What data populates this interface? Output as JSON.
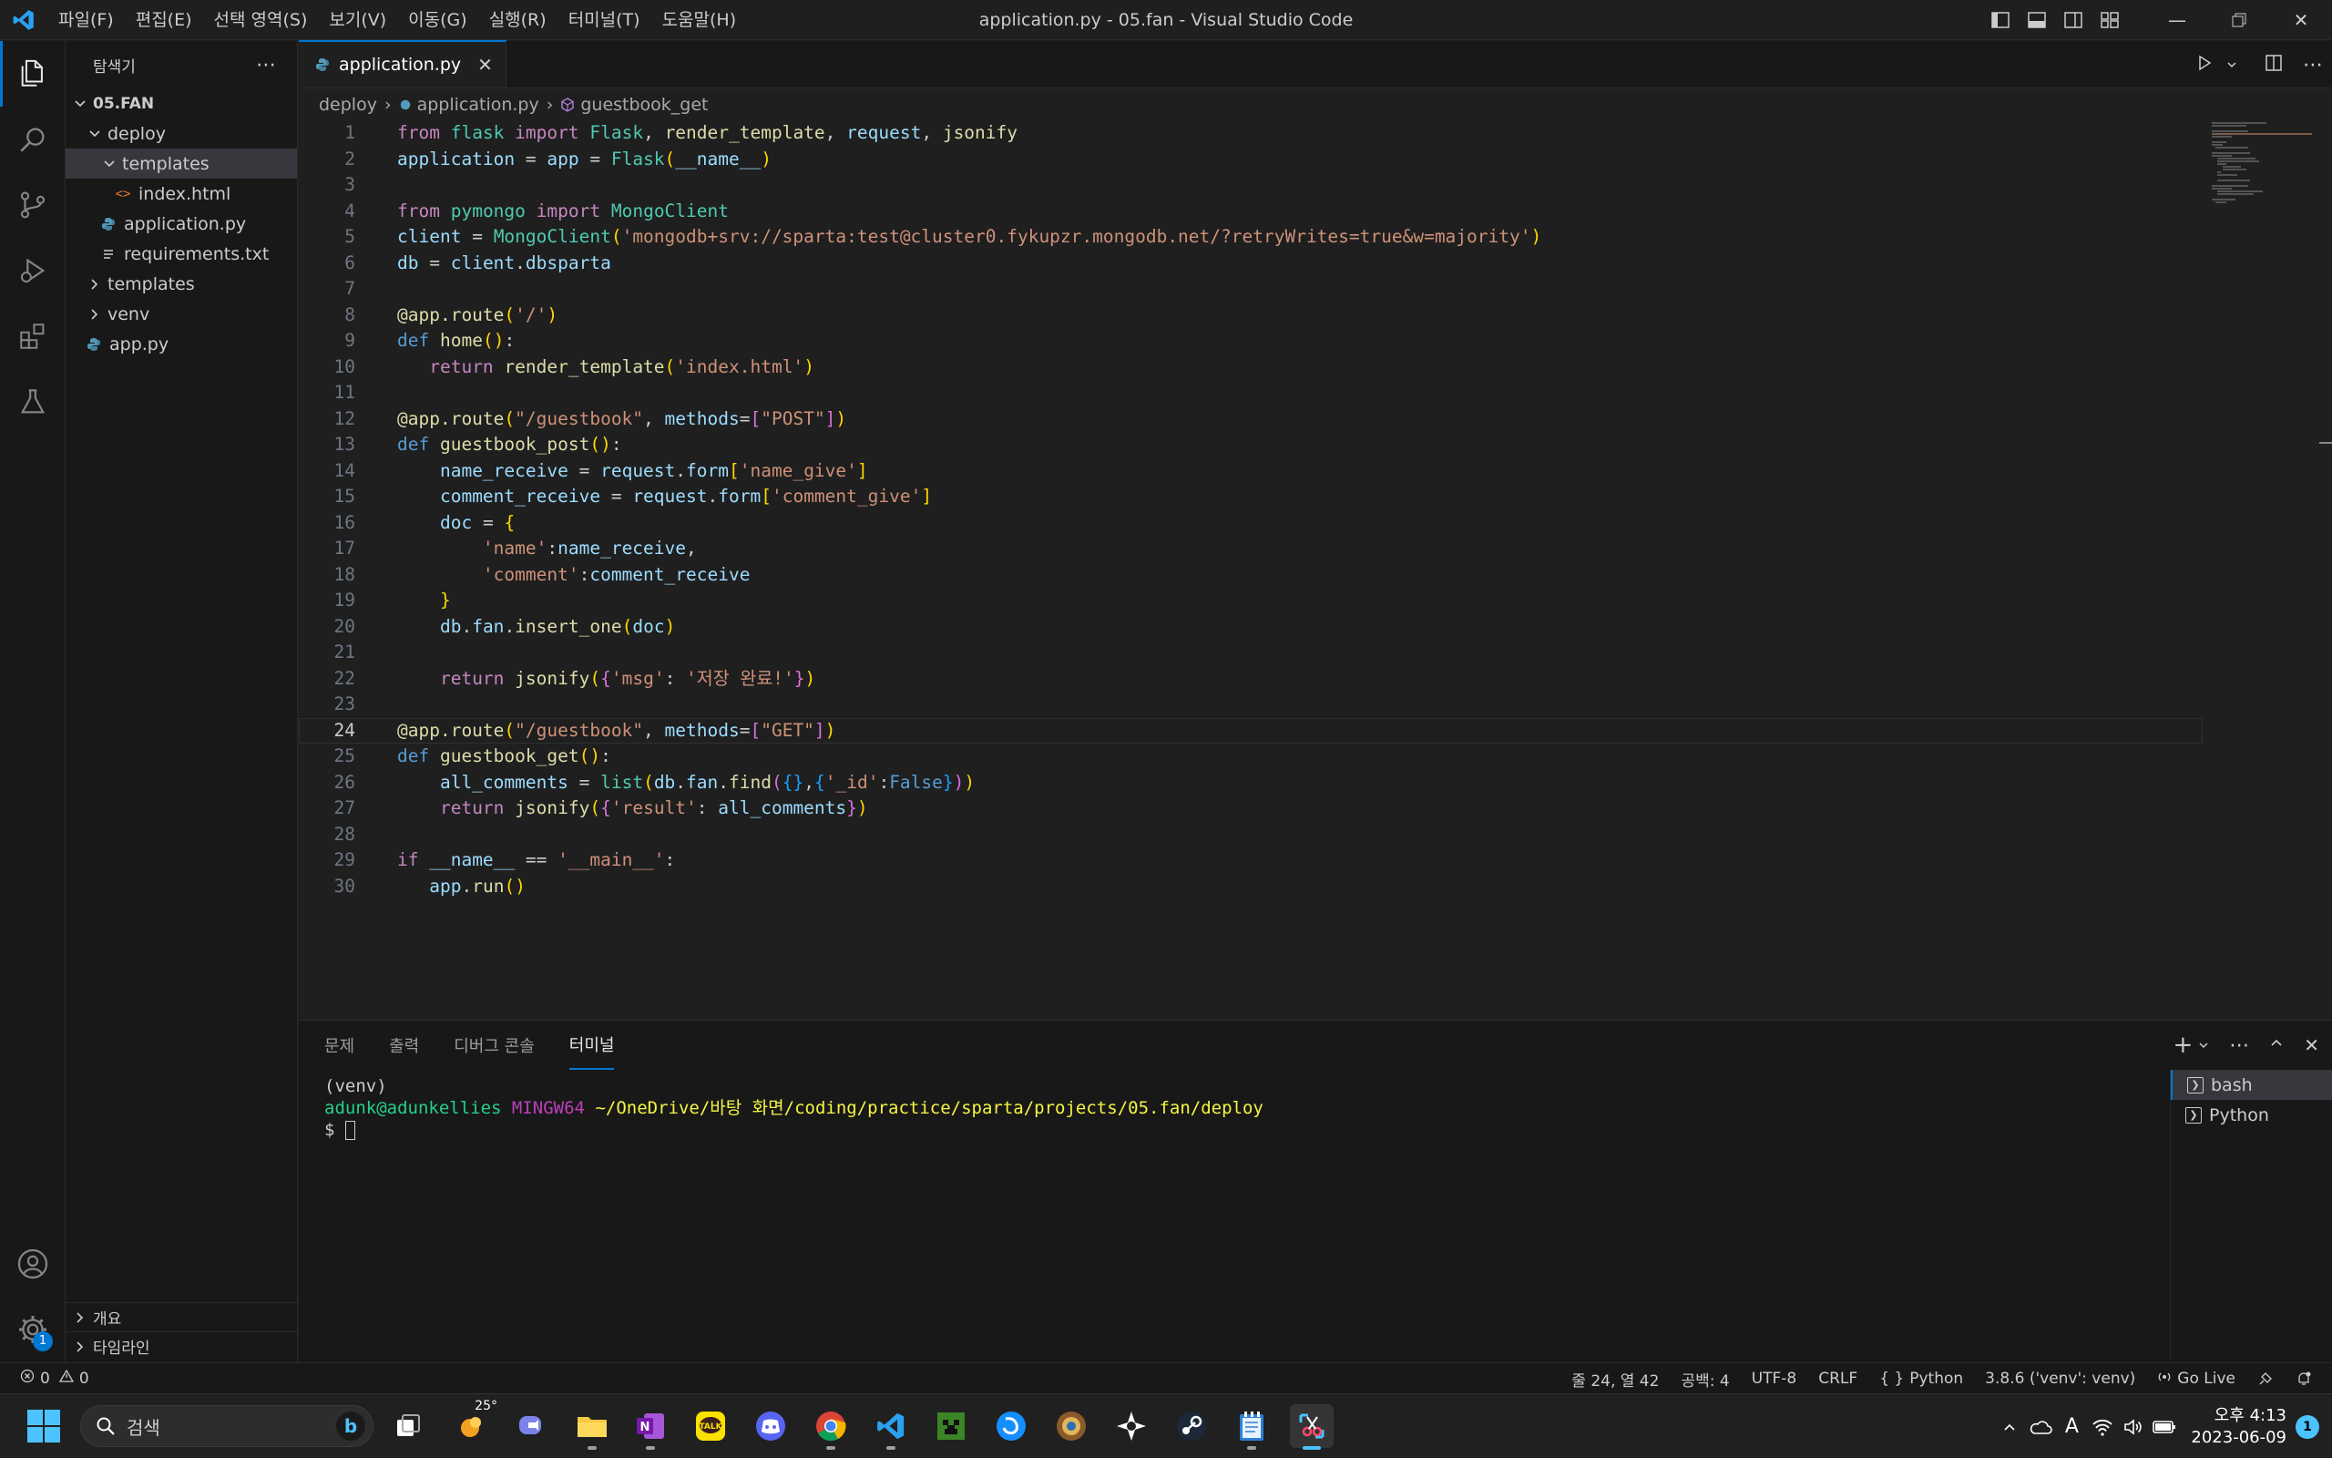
{
  "window": {
    "title": "application.py - 05.fan - Visual Studio Code",
    "menu": [
      "파일(F)",
      "편집(E)",
      "선택 영역(S)",
      "보기(V)",
      "이동(G)",
      "실행(R)",
      "터미널(T)",
      "도움말(H)"
    ]
  },
  "sidebar": {
    "title": "탐색기",
    "root": "05.FAN",
    "tree": [
      {
        "label": "deploy",
        "kind": "folder-open",
        "indent": 1
      },
      {
        "label": "templates",
        "kind": "folder-open",
        "indent": 2,
        "selected": true
      },
      {
        "label": "index.html",
        "kind": "html",
        "indent": 3
      },
      {
        "label": "application.py",
        "kind": "python",
        "indent": 2
      },
      {
        "label": "requirements.txt",
        "kind": "text",
        "indent": 2
      },
      {
        "label": "templates",
        "kind": "folder",
        "indent": 1
      },
      {
        "label": "venv",
        "kind": "folder",
        "indent": 1
      },
      {
        "label": "app.py",
        "kind": "python",
        "indent": 1
      }
    ],
    "outline_label": "개요",
    "timeline_label": "타임라인"
  },
  "editor": {
    "tab_label": "application.py",
    "breadcrumb": [
      "deploy",
      "application.py",
      "guestbook_get"
    ],
    "current_line": 24,
    "lines": [
      "from flask import Flask, render_template, request, jsonify",
      "application = app = Flask(__name__)",
      "",
      "from pymongo import MongoClient",
      "client = MongoClient('mongodb+srv://sparta:test@cluster0.fykupzr.mongodb.net/?retryWrites=true&w=majority')",
      "db = client.dbsparta",
      "",
      "@app.route('/')",
      "def home():",
      "   return render_template('index.html')",
      "",
      "@app.route(\"/guestbook\", methods=[\"POST\"])",
      "def guestbook_post():",
      "    name_receive = request.form['name_give']",
      "    comment_receive = request.form['comment_give']",
      "    doc = {",
      "        'name':name_receive,",
      "        'comment':comment_receive",
      "    }",
      "    db.fan.insert_one(doc)",
      "",
      "    return jsonify({'msg': '저장 완료!'})",
      "",
      "@app.route(\"/guestbook\", methods=[\"GET\"])",
      "def guestbook_get():",
      "    all_comments = list(db.fan.find({},{'_id':False}))",
      "    return jsonify({'result': all_comments})",
      "",
      "if __name__ == '__main__':",
      "   app.run()"
    ]
  },
  "panel": {
    "tabs": [
      "문제",
      "출력",
      "디버그 콘솔",
      "터미널"
    ],
    "active_tab": "터미널",
    "terminal": {
      "line1": "(venv)",
      "user_host": "adunk@adunkellies",
      "shell": "MINGW64",
      "path": "~/OneDrive/바탕 화면/coding/practice/sparta/projects/05.fan/deploy",
      "prompt": "$"
    },
    "terminals": [
      "bash",
      "Python"
    ]
  },
  "statusbar": {
    "errors": "0",
    "warnings": "0",
    "position": "줄 24, 열 42",
    "indent": "공백: 4",
    "encoding": "UTF-8",
    "eol": "CRLF",
    "language": "Python",
    "interpreter": "3.8.6 ('venv': venv)",
    "golive": "Go Live"
  },
  "taskbar": {
    "search_placeholder": "검색",
    "weather_temp": "25°",
    "clock_time": "오후 4:13",
    "clock_date": "2023-06-09",
    "notifications": "1"
  },
  "colors": {
    "accent": "#0078d4",
    "editor_bg": "#1f1f1f",
    "sidebar_bg": "#181818",
    "string": "#ce9178",
    "keyword": "#c586c0",
    "function": "#dcdcaa"
  }
}
